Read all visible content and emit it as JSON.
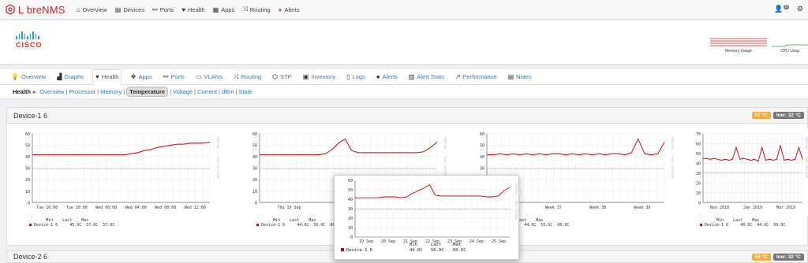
{
  "brand": {
    "prefix": "L",
    "name": "breNMS"
  },
  "nav": [
    {
      "label": "Overview",
      "icon": "home-icon",
      "glyph": "⌂"
    },
    {
      "label": "Devices",
      "icon": "server-icon",
      "glyph": "▤"
    },
    {
      "label": "Ports",
      "icon": "link-icon",
      "glyph": "⚯"
    },
    {
      "label": "Health",
      "icon": "heartbeat-icon",
      "glyph": "♥"
    },
    {
      "label": "Apps",
      "icon": "tasks-icon",
      "glyph": "▦"
    },
    {
      "label": "Routing",
      "icon": "random-icon",
      "glyph": "⤨"
    },
    {
      "label": "Alerts",
      "icon": "alert-icon",
      "glyph": "●"
    }
  ],
  "user_badge": "0",
  "device": {
    "logo_text": "CISCO",
    "mini_graphs": [
      "Memory Usage",
      "CPU Usag"
    ]
  },
  "tabs": [
    {
      "label": "Overview",
      "icon": "lightbulb-icon",
      "glyph": "💡"
    },
    {
      "label": "Graphs",
      "icon": "area-chart-icon",
      "glyph": "▟"
    },
    {
      "label": "Health",
      "icon": "heartbeat-icon",
      "glyph": "♥"
    },
    {
      "label": "Apps",
      "icon": "cubes-icon",
      "glyph": "❖"
    },
    {
      "label": "Ports",
      "icon": "link-icon",
      "glyph": "⚯"
    },
    {
      "label": "VLANs",
      "icon": "vlan-icon",
      "glyph": "▭"
    },
    {
      "label": "Routing",
      "icon": "random-icon",
      "glyph": "⤨"
    },
    {
      "label": "STP",
      "icon": "sitemap-icon",
      "glyph": "⌬"
    },
    {
      "label": "Inventory",
      "icon": "cube-icon",
      "glyph": "▣"
    },
    {
      "label": "Logs",
      "icon": "file-icon",
      "glyph": "▯"
    },
    {
      "label": "Alerts",
      "icon": "alert-icon",
      "glyph": "●"
    },
    {
      "label": "Alert Stats",
      "icon": "bar-chart-icon",
      "glyph": "▥"
    },
    {
      "label": "Performance",
      "icon": "line-chart-icon",
      "glyph": "↗"
    },
    {
      "label": "Notes",
      "icon": "notes-icon",
      "glyph": "▤"
    }
  ],
  "subnav": {
    "title": "Health »",
    "links": [
      "Overview",
      "Processor",
      "Memory",
      "Temperature",
      "Voltage",
      "Current",
      "dBm",
      "State"
    ],
    "active": "Temperature"
  },
  "panels": [
    {
      "title": "Device-1 6",
      "badge_value": "57 °C",
      "badge_low": "low: 32 °C"
    },
    {
      "title": "Device-2 6",
      "badge_value": "56 °C",
      "badge_low": "low: 32 °C"
    }
  ],
  "rrd_label": "RRDTOOL / TOBI OETIKER",
  "graphs": [
    {
      "y_ticks": [
        "60",
        "50",
        "40",
        "30",
        "20",
        "10",
        "0"
      ],
      "x_ticks": [
        "Tue 16:00",
        "Tue 20:00",
        "Wed 00:00",
        "Wed 04:00",
        "Wed 08:00",
        "Wed 12:00"
      ],
      "legend_header": "       Min    Last    Max",
      "legend_name": "Device-1 6",
      "legend_values": "     45.9C  57.0C  57.0C",
      "series": [
        45,
        45,
        45,
        45,
        45,
        45,
        45,
        45,
        45,
        45,
        45,
        45,
        45,
        45,
        45,
        46,
        47,
        49,
        50,
        52,
        53,
        54,
        55,
        55,
        56,
        56,
        56,
        57
      ]
    },
    {
      "y_ticks": [
        "60",
        "50",
        "40",
        "30",
        "20",
        "10",
        "0"
      ],
      "x_ticks": [
        "Thu 19 Sep",
        "Fri 20 Sep",
        "Sat 21"
      ],
      "legend_header": "       Min    Last    Max",
      "legend_name": "Device-1 6",
      "legend_values": "     44.0C  56.9C  60.0C",
      "series": [
        45,
        45,
        45,
        45,
        45,
        45,
        45,
        45,
        45,
        45,
        46,
        50,
        56,
        60,
        49,
        47,
        47,
        47,
        47,
        47,
        47,
        47,
        47,
        47,
        47,
        48,
        52,
        57
      ]
    },
    {
      "y_ticks": [
        "60",
        "50",
        "40",
        "30",
        "20",
        "10",
        "0"
      ],
      "x_ticks": [
        "Week 36",
        "Week 37",
        "Week 38",
        "Week 39"
      ],
      "legend_header": "       Min    Last    Max",
      "legend_name": "Device-1 6",
      "legend_values": "     44.0C  55.6C  60.0C",
      "series": [
        45,
        45,
        46,
        45,
        46,
        45,
        46,
        45,
        46,
        45,
        46,
        46,
        45,
        46,
        45,
        46,
        45,
        46,
        45,
        46,
        46,
        45,
        47,
        60,
        46,
        45,
        46,
        57
      ]
    },
    {
      "y_ticks": [
        "70",
        "60",
        "50",
        "40",
        "30",
        "20",
        "10",
        "0"
      ],
      "x_ticks": [
        "Nov 2018",
        "Jan 2019",
        "Mar 2019"
      ],
      "legend_header": "       Min    Last    Max",
      "legend_name": "Device-1 6",
      "legend_values": "     40.0C  44.0C  69.0C",
      "series": [
        48,
        48,
        47,
        48,
        47,
        46,
        47,
        46,
        47,
        60,
        47,
        48,
        47,
        46,
        47,
        45,
        60,
        46,
        47,
        46,
        47,
        62,
        46,
        47,
        46,
        47,
        60,
        47
      ]
    }
  ],
  "tooltip": {
    "y_ticks": [
      "60",
      "50",
      "40",
      "30",
      "20",
      "10",
      "0"
    ],
    "x_ticks": [
      "19 Sep",
      "20 Sep",
      "21 Sep",
      "22 Sep",
      "23 Sep",
      "24 Sep",
      "25 Sep"
    ],
    "legend_name": "Device-1 6",
    "min_label": "Min",
    "last_label": "Last",
    "max_label": "Max",
    "min": "44.0C",
    "last": "56.9C",
    "max": "60.0C",
    "series": [
      45,
      45,
      45,
      45,
      45,
      46,
      46,
      46,
      45,
      46,
      50,
      53,
      56,
      60,
      48,
      47,
      47,
      47,
      47,
      47,
      47,
      47,
      47,
      46,
      46,
      47,
      53,
      57
    ]
  }
}
